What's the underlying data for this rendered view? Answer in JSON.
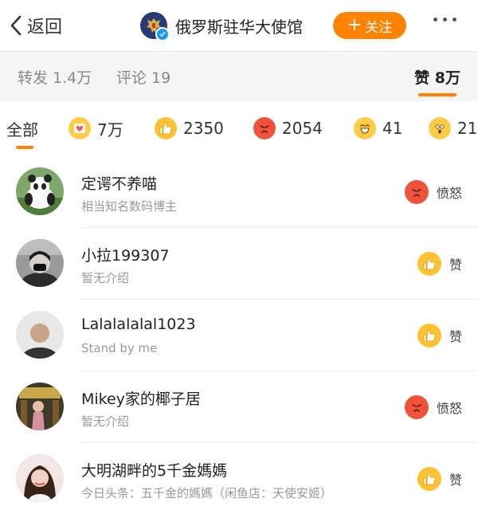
{
  "header": {
    "back_label": "返回",
    "account_name": "俄罗斯驻华大使馆",
    "follow_label": "关注"
  },
  "tabs": {
    "repost": "转发 1.4万",
    "comments": "评论 19",
    "likes": "赞 8万"
  },
  "filters": {
    "all": "全部",
    "items": [
      {
        "icon": "heart-emoji-icon",
        "count": "7万"
      },
      {
        "icon": "thumbs-up-emoji-icon",
        "count": "2350"
      },
      {
        "icon": "angry-emoji-icon",
        "count": "2054"
      },
      {
        "icon": "laughing-emoji-icon",
        "count": "41"
      },
      {
        "icon": "surprised-emoji-icon",
        "count": "21"
      }
    ]
  },
  "users": [
    {
      "name": "定谔不养喵",
      "desc": "相当知名数码博主",
      "reaction": "愤怒",
      "reaction_icon": "angry-emoji-icon"
    },
    {
      "name": "小拉199307",
      "desc": "暂无介绍",
      "reaction": "赞",
      "reaction_icon": "thumbs-up-emoji-icon"
    },
    {
      "name": "Lalalalalal1023",
      "desc": "Stand by me",
      "reaction": "赞",
      "reaction_icon": "thumbs-up-emoji-icon"
    },
    {
      "name": "Mikey家的椰子居",
      "desc": "暂无介绍",
      "reaction": "愤怒",
      "reaction_icon": "angry-emoji-icon"
    },
    {
      "name": "大明湖畔的5千金媽媽",
      "desc": "今日头条：五千金的媽媽（闲鱼店：天使安姬）",
      "reaction": "赞",
      "reaction_icon": "thumbs-up-emoji-icon"
    }
  ],
  "colors": {
    "accent": "#ff8200",
    "angry": "#f0533b",
    "thumb": "#ffc233"
  }
}
